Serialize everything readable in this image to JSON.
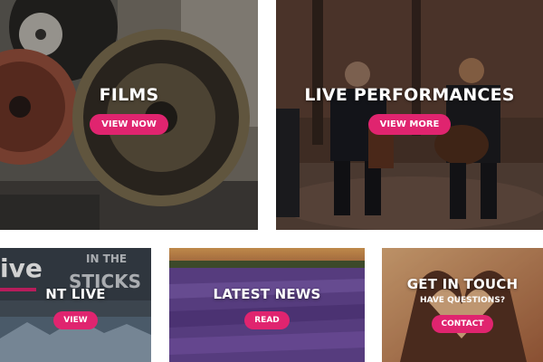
{
  "tiles": {
    "films": {
      "title": "FILMS",
      "button": "VIEW NOW"
    },
    "live_performances": {
      "title": "LIVE PERFORMANCES",
      "button": "VIEW MORE"
    },
    "nt_live": {
      "title": "NT LIVE",
      "button": "VIEW",
      "image_text": [
        "ive",
        "IN THE",
        "STICKS"
      ]
    },
    "latest_news": {
      "title": "LATEST NEWS",
      "button": "READ"
    },
    "get_in_touch": {
      "title": "GET IN TOUCH",
      "subtitle": "HAVE QUESTIONS?",
      "button": "CONTACT"
    }
  },
  "colors": {
    "accent": "#e0246f",
    "overlay_text": "#ffffff"
  }
}
